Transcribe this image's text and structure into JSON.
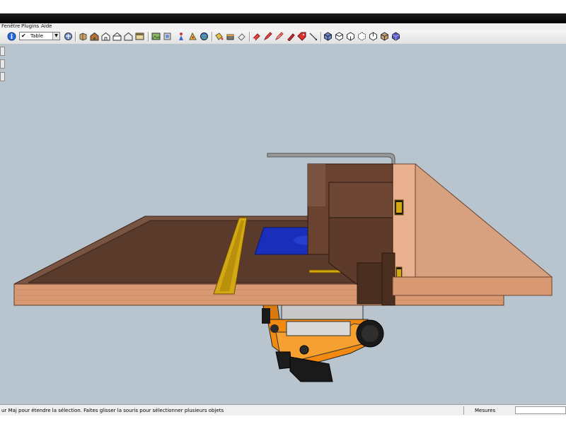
{
  "menu": [
    {
      "label": "Fenêtre"
    },
    {
      "label": "Plugins"
    },
    {
      "label": "Aide"
    }
  ],
  "toolbar": {
    "layer_combo": {
      "value": "Table"
    },
    "icons": [
      "info-icon",
      "components-icon",
      "move-object-icon",
      "house-icon",
      "house-outline-icon",
      "house-front-icon",
      "window-icon",
      "photo-export-icon",
      "model-export-icon",
      "figure-icon",
      "position-camera-icon",
      "globe-icon",
      "paint-bucket-icon",
      "paint-can-icon",
      "eraser-icon",
      "tag-icon",
      "eraser-red-icon",
      "pencil-red-icon",
      "pencil-pink-icon",
      "tape-red-icon",
      "dimension-icon",
      "iso-view-icon",
      "top-view-icon",
      "front-view-icon",
      "right-view-icon",
      "back-view-icon",
      "wireframe-style-icon",
      "textured-style-icon"
    ]
  },
  "viewport": {
    "description_colors": {
      "sky": "#b8c5cf",
      "wood_dark": "#5a3a2a",
      "wood_light": "#d4a080",
      "insert": "#1a2ebc",
      "rail": "#d4a815",
      "router_orange": "#f28a12"
    }
  },
  "statusbar": {
    "hint": "ur Maj pour étendre la sélection. Faites glisser la souris pour sélectionner plusieurs objets",
    "measure_label": "Mesures",
    "measure_value": ""
  }
}
